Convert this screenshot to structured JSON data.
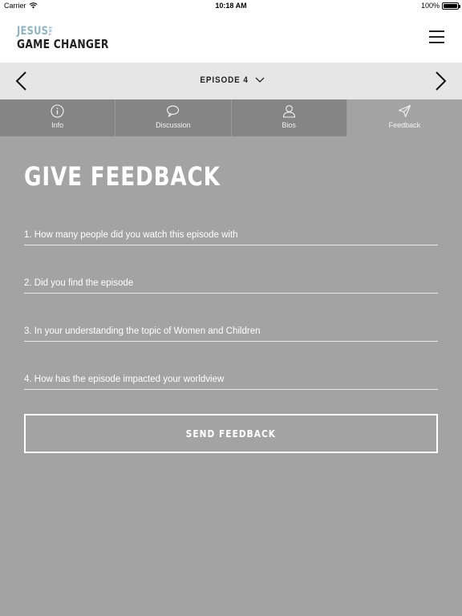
{
  "status_bar": {
    "carrier": "Carrier",
    "time": "10:18 AM",
    "battery": "100%"
  },
  "header": {
    "logo_line1": "JESUS",
    "logo_the": "THE",
    "logo_line2": "GAME CHANGER",
    "menu_icon": "hamburger-menu-icon"
  },
  "episode_nav": {
    "label": "EPISODE 4",
    "prev_icon": "chevron-left-icon",
    "next_icon": "chevron-right-icon",
    "dropdown_icon": "chevron-down-icon"
  },
  "tabs": [
    {
      "label": "Info",
      "icon": "info-icon",
      "active": false
    },
    {
      "label": "Discussion",
      "icon": "speech-bubble-icon",
      "active": false
    },
    {
      "label": "Bios",
      "icon": "person-icon",
      "active": false
    },
    {
      "label": "Feedback",
      "icon": "paper-plane-icon",
      "active": true
    }
  ],
  "form": {
    "title": "GIVE FEEDBACK",
    "questions": [
      {
        "placeholder": "1. How many people did you watch this episode with",
        "value": ""
      },
      {
        "placeholder": "2. Did you find the episode",
        "value": ""
      },
      {
        "placeholder": "3. In your understanding the topic of Women and Children",
        "value": ""
      },
      {
        "placeholder": "4. How has the episode impacted your worldview",
        "value": ""
      }
    ],
    "submit_label": "SEND FEEDBACK"
  },
  "colors": {
    "background": "#a3a3a3",
    "tab_inactive": "#858585",
    "episode_bar": "#e6e6e6",
    "logo_accent": "#8fb3bf",
    "text_light": "#ffffff"
  }
}
